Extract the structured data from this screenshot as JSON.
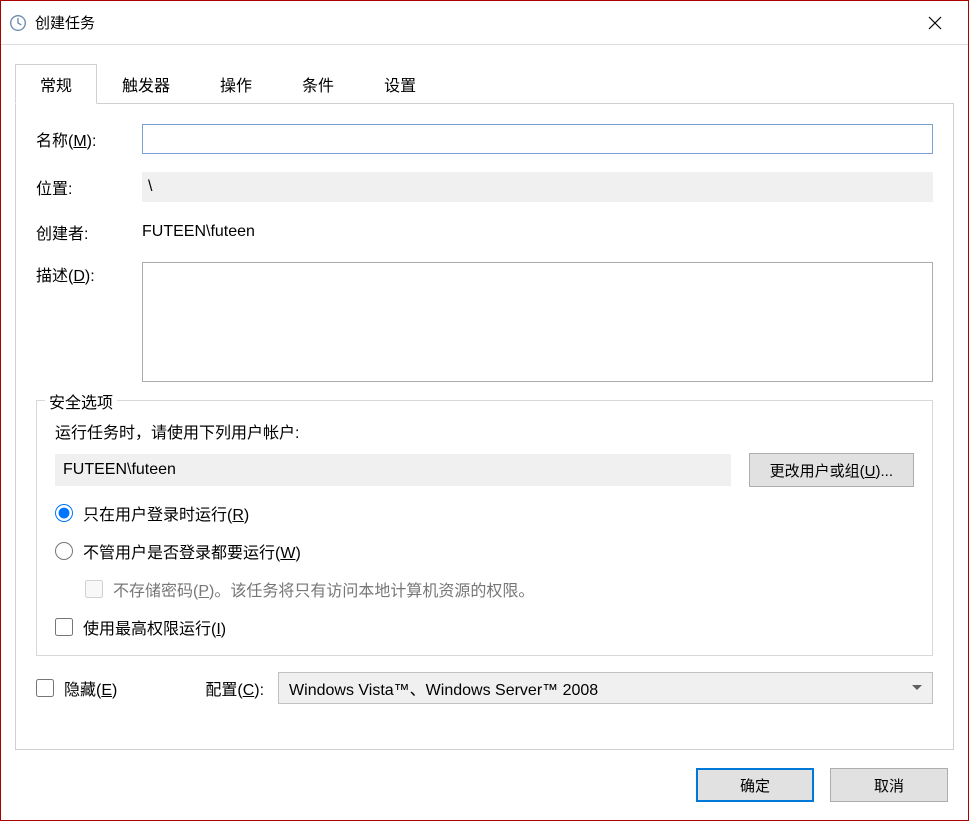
{
  "window": {
    "title": "创建任务"
  },
  "tabs": {
    "general": "常规",
    "triggers": "触发器",
    "actions": "操作",
    "conditions": "条件",
    "settings": "设置"
  },
  "general": {
    "name_label_pre": "名称(",
    "name_label_u": "M",
    "name_label_post": "):",
    "name_value": "",
    "location_label": "位置:",
    "location_value": "\\",
    "creator_label": "创建者:",
    "creator_value": "FUTEEN\\futeen",
    "desc_label_pre": "描述(",
    "desc_label_u": "D",
    "desc_label_post": "):",
    "desc_value": ""
  },
  "security": {
    "legend": "安全选项",
    "account_label": "运行任务时，请使用下列用户帐户:",
    "account_value": "FUTEEN\\futeen",
    "change_btn_pre": "更改用户或组(",
    "change_btn_u": "U",
    "change_btn_post": ")...",
    "radio1_pre": "只在用户登录时运行(",
    "radio1_u": "R",
    "radio1_post": ")",
    "radio2_pre": "不管用户是否登录都要运行(",
    "radio2_u": "W",
    "radio2_post": ")",
    "nopwd_pre": "不存储密码(",
    "nopwd_u": "P",
    "nopwd_post": ")。该任务将只有访问本地计算机资源的权限。",
    "highest_pre": "使用最高权限运行(",
    "highest_u": "I",
    "highest_post": ")"
  },
  "bottom": {
    "hidden_pre": "隐藏(",
    "hidden_u": "E",
    "hidden_post": ")",
    "config_pre": "配置(",
    "config_u": "C",
    "config_post": "):",
    "config_value": "Windows Vista™、Windows Server™ 2008"
  },
  "buttons": {
    "ok": "确定",
    "cancel": "取消"
  }
}
